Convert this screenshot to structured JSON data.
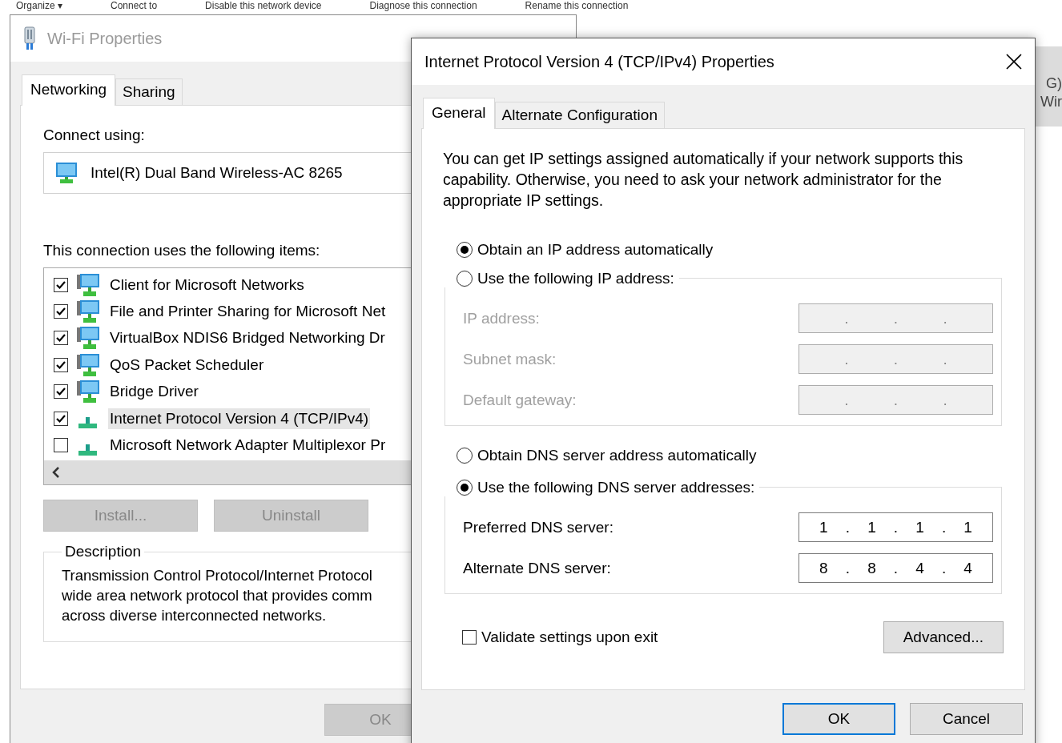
{
  "explorer_toolbar": [
    "Organize ▾",
    "Connect to",
    "Disable this network device",
    "Diagnose this connection",
    "Rename this connection"
  ],
  "background_window_text": [
    "G)",
    "Wir"
  ],
  "wifi_window": {
    "title": "Wi-Fi Properties",
    "tabs": [
      {
        "label": "Networking",
        "selected": true
      },
      {
        "label": "Sharing",
        "selected": false
      }
    ],
    "connect_using_label": "Connect using:",
    "adapter": "Intel(R) Dual Band Wireless-AC 8265",
    "items_label": "This connection uses the following items:",
    "items": [
      {
        "kind": "client",
        "label": "Client for Microsoft Networks",
        "checked": true,
        "selected": false
      },
      {
        "kind": "service",
        "label": "File and Printer Sharing for Microsoft Net",
        "checked": true,
        "selected": false
      },
      {
        "kind": "service",
        "label": "VirtualBox NDIS6 Bridged Networking Dr",
        "checked": true,
        "selected": false
      },
      {
        "kind": "service",
        "label": "QoS Packet Scheduler",
        "checked": true,
        "selected": false
      },
      {
        "kind": "service",
        "label": "Bridge Driver",
        "checked": true,
        "selected": false
      },
      {
        "kind": "protocol",
        "label": "Internet Protocol Version 4 (TCP/IPv4)",
        "checked": true,
        "selected": true
      },
      {
        "kind": "protocol",
        "label": "Microsoft Network Adapter Multiplexor Pr",
        "checked": false,
        "selected": false
      }
    ],
    "buttons": [
      {
        "label": "Install...",
        "disabled": true
      },
      {
        "label": "Uninstall",
        "disabled": true
      }
    ],
    "description_title": "Description",
    "description": "Transmission Control Protocol/Internet Protocol\nwide area network protocol that provides comm\nacross diverse interconnected networks.",
    "ok": {
      "label": "OK",
      "disabled": true
    }
  },
  "ipv4_dialog": {
    "title": "Internet Protocol Version 4 (TCP/IPv4) Properties",
    "tabs": [
      {
        "label": "General",
        "selected": true
      },
      {
        "label": "Alternate Configuration",
        "selected": false
      }
    ],
    "intro": "You can get IP settings assigned automatically if your network supports this capability. Otherwise, you need to ask your network administrator for the appropriate IP settings.",
    "separator": ".",
    "ip_auto": {
      "label": "Obtain an IP address automatically",
      "selected": true
    },
    "ip_manual": {
      "label": "Use the following IP address:",
      "selected": false,
      "fields": [
        {
          "label": "IP address:"
        },
        {
          "label": "Subnet mask:"
        },
        {
          "label": "Default gateway:"
        }
      ]
    },
    "dns_auto": {
      "label": "Obtain DNS server address automatically",
      "selected": false
    },
    "dns_manual": {
      "label": "Use the following DNS server addresses:",
      "selected": true,
      "fields": [
        {
          "label": "Preferred DNS server:",
          "octets": [
            "1",
            "1",
            "1",
            "1"
          ]
        },
        {
          "label": "Alternate DNS server:",
          "octets": [
            "8",
            "8",
            "4",
            "4"
          ]
        }
      ]
    },
    "validate": {
      "label": "Validate settings upon exit",
      "checked": false
    },
    "advanced": "Advanced...",
    "ok": "OK",
    "cancel": "Cancel"
  }
}
